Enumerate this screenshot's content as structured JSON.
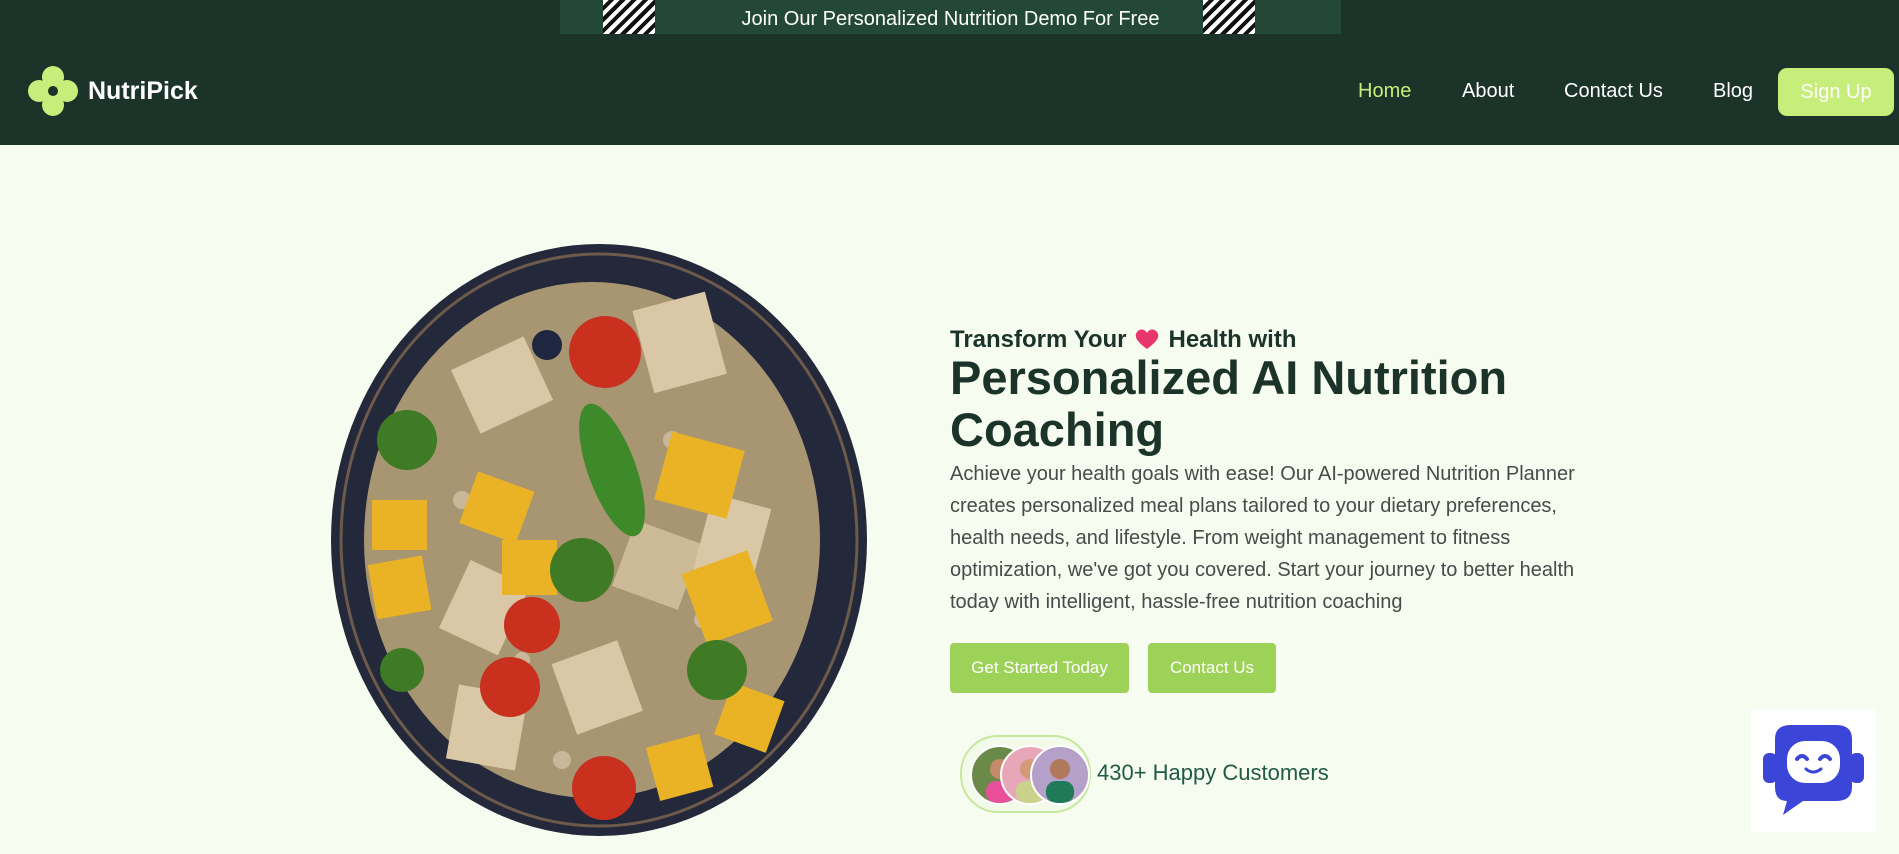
{
  "banner": {
    "text": "Join Our Personalized Nutrition Demo For Free"
  },
  "brand": {
    "name": "NutriPick",
    "icon": "clover-logo-icon",
    "accent": "#c7ee7a"
  },
  "nav": {
    "items": [
      {
        "label": "Home",
        "active": true
      },
      {
        "label": "About",
        "active": false
      },
      {
        "label": "Contact Us",
        "active": false
      },
      {
        "label": "Blog",
        "active": false
      }
    ],
    "signup": "Sign Up"
  },
  "hero": {
    "subtitle_pre": "Transform Your",
    "subtitle_post": "Health with",
    "title": "Personalized AI Nutrition Coaching",
    "description": "Achieve your health goals with ease! Our AI-powered Nutrition Planner creates personalized meal plans tailored to your dietary preferences, health needs, and lifestyle. From weight management to fitness optimization, we've got you covered. Start your journey to better health today with intelligent, hassle-free nutrition coaching",
    "cta_primary": "Get Started Today",
    "cta_secondary": "Contact Us",
    "customers": "430+ Happy Customers",
    "image": "salad-bowl-image"
  },
  "chatbot": {
    "icon": "chatbot-icon"
  },
  "colors": {
    "header_bg": "#1b3329",
    "page_bg": "#f7fcf0",
    "button": "#9dd258",
    "heading": "#1b3329"
  }
}
